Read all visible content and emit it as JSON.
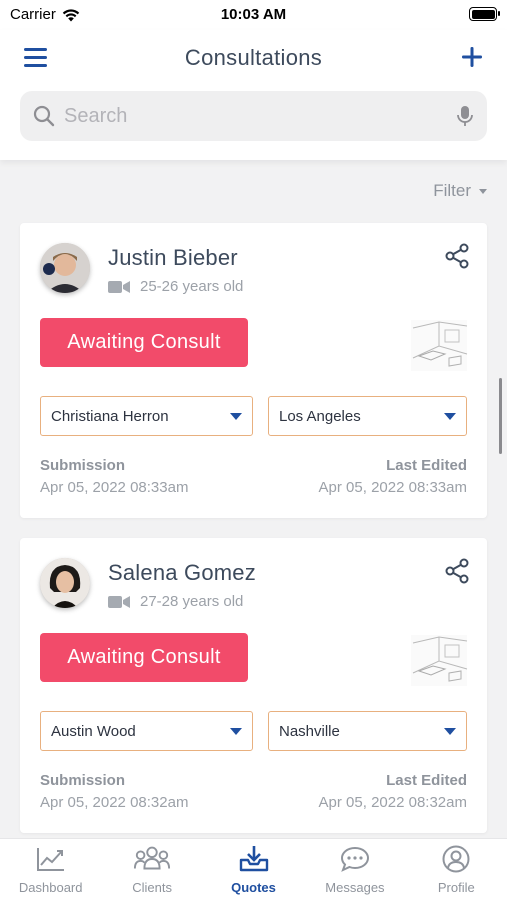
{
  "status_bar": {
    "carrier": "Carrier",
    "time": "10:03 AM"
  },
  "header": {
    "title": "Consultations"
  },
  "search": {
    "placeholder": "Search"
  },
  "filter": {
    "label": "Filter"
  },
  "colors": {
    "accent": "#1f4fa0",
    "status_button": "#f24b6a",
    "select_border": "#e8b07f"
  },
  "consultations": [
    {
      "name": "Justin Bieber",
      "age": "25-26 years old",
      "status": "Awaiting Consult",
      "consultant": "Christiana Herron",
      "location": "Los Angeles",
      "submission_label": "Submission",
      "submission": "Apr 05, 2022 08:33am",
      "last_edited_label": "Last Edited",
      "last_edited": "Apr 05, 2022 08:33am"
    },
    {
      "name": "Salena Gomez",
      "age": "27-28 years old",
      "status": "Awaiting Consult",
      "consultant": "Austin Wood",
      "location": "Nashville",
      "submission_label": "Submission",
      "submission": "Apr 05, 2022 08:32am",
      "last_edited_label": "Last Edited",
      "last_edited": "Apr 05, 2022 08:32am"
    }
  ],
  "tabs": [
    {
      "label": "Dashboard",
      "icon": "chart-icon"
    },
    {
      "label": "Clients",
      "icon": "users-icon"
    },
    {
      "label": "Quotes",
      "icon": "inbox-download-icon",
      "active": true
    },
    {
      "label": "Messages",
      "icon": "chat-icon"
    },
    {
      "label": "Profile",
      "icon": "user-circle-icon"
    }
  ]
}
